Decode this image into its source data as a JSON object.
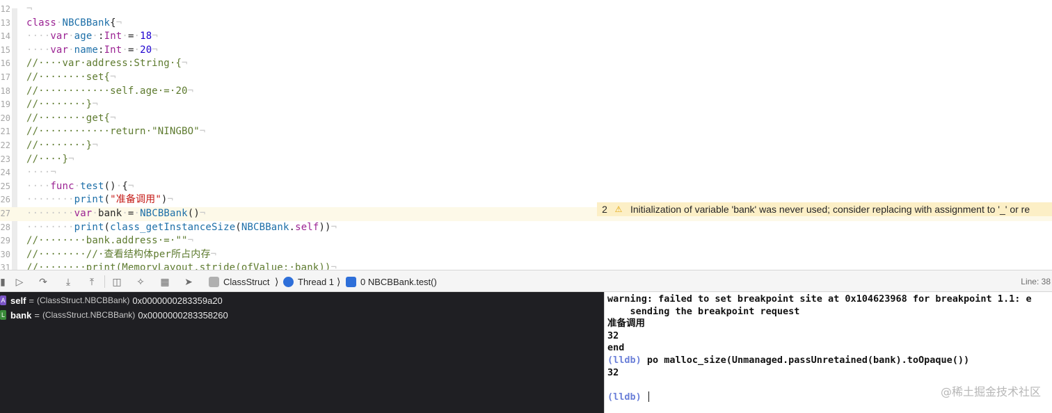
{
  "editor": {
    "lines": [
      {
        "num": "12",
        "segs": [
          {
            "t": "¬",
            "c": "ws"
          }
        ]
      },
      {
        "num": "13",
        "segs": [
          {
            "t": "class",
            "c": "kw"
          },
          {
            "t": "·",
            "c": "ws"
          },
          {
            "t": "NBCBBank",
            "c": "ty"
          },
          {
            "t": "{",
            "c": ""
          },
          {
            "t": "¬",
            "c": "ws"
          }
        ]
      },
      {
        "num": "14",
        "segs": [
          {
            "t": "····",
            "c": "ws"
          },
          {
            "t": "var",
            "c": "kw"
          },
          {
            "t": "·",
            "c": "ws"
          },
          {
            "t": "age",
            "c": "ty"
          },
          {
            "t": "·",
            "c": "ws"
          },
          {
            "t": ":",
            "c": ""
          },
          {
            "t": "Int",
            "c": "kw"
          },
          {
            "t": "·",
            "c": "ws"
          },
          {
            "t": "=",
            "c": ""
          },
          {
            "t": "·",
            "c": "ws"
          },
          {
            "t": "18",
            "c": "num"
          },
          {
            "t": "¬",
            "c": "ws"
          }
        ]
      },
      {
        "num": "15",
        "segs": [
          {
            "t": "····",
            "c": "ws"
          },
          {
            "t": "var",
            "c": "kw"
          },
          {
            "t": "·",
            "c": "ws"
          },
          {
            "t": "name",
            "c": "ty"
          },
          {
            "t": ":",
            "c": ""
          },
          {
            "t": "Int",
            "c": "kw"
          },
          {
            "t": "·",
            "c": "ws"
          },
          {
            "t": "=",
            "c": ""
          },
          {
            "t": "·",
            "c": "ws"
          },
          {
            "t": "20",
            "c": "num"
          },
          {
            "t": "¬",
            "c": "ws"
          }
        ]
      },
      {
        "num": "16",
        "segs": [
          {
            "t": "//····var·address:String·{",
            "c": "cm"
          },
          {
            "t": "¬",
            "c": "ws"
          }
        ]
      },
      {
        "num": "17",
        "segs": [
          {
            "t": "//········set{",
            "c": "cm"
          },
          {
            "t": "¬",
            "c": "ws"
          }
        ]
      },
      {
        "num": "18",
        "segs": [
          {
            "t": "//············self.age·=·20",
            "c": "cm"
          },
          {
            "t": "¬",
            "c": "ws"
          }
        ]
      },
      {
        "num": "19",
        "segs": [
          {
            "t": "//········}",
            "c": "cm"
          },
          {
            "t": "¬",
            "c": "ws"
          }
        ]
      },
      {
        "num": "20",
        "segs": [
          {
            "t": "//········get{",
            "c": "cm"
          },
          {
            "t": "¬",
            "c": "ws"
          }
        ]
      },
      {
        "num": "21",
        "segs": [
          {
            "t": "//············return·\"NINGBO\"",
            "c": "cm"
          },
          {
            "t": "¬",
            "c": "ws"
          }
        ]
      },
      {
        "num": "22",
        "segs": [
          {
            "t": "//········}",
            "c": "cm"
          },
          {
            "t": "¬",
            "c": "ws"
          }
        ]
      },
      {
        "num": "23",
        "segs": [
          {
            "t": "//····}",
            "c": "cm"
          },
          {
            "t": "¬",
            "c": "ws"
          }
        ]
      },
      {
        "num": "24",
        "segs": [
          {
            "t": "····¬",
            "c": "ws"
          }
        ]
      },
      {
        "num": "25",
        "segs": [
          {
            "t": "····",
            "c": "ws"
          },
          {
            "t": "func",
            "c": "kw"
          },
          {
            "t": "·",
            "c": "ws"
          },
          {
            "t": "test",
            "c": "ty"
          },
          {
            "t": "()",
            "c": ""
          },
          {
            "t": "·",
            "c": "ws"
          },
          {
            "t": "{",
            "c": ""
          },
          {
            "t": "¬",
            "c": "ws"
          }
        ]
      },
      {
        "num": "26",
        "segs": [
          {
            "t": "········",
            "c": "ws"
          },
          {
            "t": "print",
            "c": "ty"
          },
          {
            "t": "(",
            "c": ""
          },
          {
            "t": "\"准备调用\"",
            "c": "str"
          },
          {
            "t": ")",
            "c": ""
          },
          {
            "t": "¬",
            "c": "ws"
          }
        ]
      },
      {
        "num": "27",
        "segs": [
          {
            "t": "········",
            "c": "ws"
          },
          {
            "t": "var",
            "c": "kw"
          },
          {
            "t": "·",
            "c": "ws"
          },
          {
            "t": "bank",
            "c": ""
          },
          {
            "t": "·",
            "c": "ws"
          },
          {
            "t": "=",
            "c": ""
          },
          {
            "t": "·",
            "c": "ws"
          },
          {
            "t": "NBCBBank",
            "c": "ty"
          },
          {
            "t": "()",
            "c": ""
          },
          {
            "t": "¬",
            "c": "ws"
          }
        ]
      },
      {
        "num": "28",
        "segs": [
          {
            "t": "········",
            "c": "ws"
          },
          {
            "t": "print",
            "c": "ty"
          },
          {
            "t": "(",
            "c": ""
          },
          {
            "t": "class_getInstanceSize",
            "c": "ty"
          },
          {
            "t": "(",
            "c": ""
          },
          {
            "t": "NBCBBank",
            "c": "ty"
          },
          {
            "t": ".",
            "c": ""
          },
          {
            "t": "self",
            "c": "kw"
          },
          {
            "t": "))",
            "c": ""
          },
          {
            "t": "¬",
            "c": "ws"
          }
        ]
      },
      {
        "num": "29",
        "segs": [
          {
            "t": "//········bank.address·=·\"\"",
            "c": "cm"
          },
          {
            "t": "¬",
            "c": "ws"
          }
        ]
      },
      {
        "num": "30",
        "segs": [
          {
            "t": "//········//·查看结构体per所占内存",
            "c": "cm"
          },
          {
            "t": "¬",
            "c": "ws"
          }
        ]
      },
      {
        "num": "31",
        "segs": [
          {
            "t": "//········print(MemoryLayout.stride(ofValue:·bank))",
            "c": "cm"
          },
          {
            "t": "¬",
            "c": "ws"
          }
        ]
      }
    ],
    "highlighted_line": "27",
    "warning": {
      "count": "2",
      "icon": "warning-triangle-icon",
      "text": "Initialization of variable 'bank' was never used; consider replacing with assignment to '_' or re"
    }
  },
  "debug_bar": {
    "breadcrumbs": {
      "target": "ClassStruct",
      "thread": "Thread 1",
      "frame": "0 NBCBBank.test()"
    },
    "line_indicator": "Line: 38"
  },
  "variables": [
    {
      "badge": "A",
      "badge_color": "#7b55c7",
      "name": "self",
      "eq": "=",
      "type": "(ClassStruct.NBCBBank)",
      "value": "0x0000000283359a20"
    },
    {
      "badge": "L",
      "badge_color": "#3a8b3a",
      "name": "bank",
      "eq": "=",
      "type": "(ClassStruct.NBCBBank)",
      "value": "0x0000000283358260"
    }
  ],
  "console": {
    "lines": [
      {
        "text": "warning: failed to set breakpoint site at 0x104623968 for breakpoint 1.1: e",
        "prompt": ""
      },
      {
        "text": "    sending the breakpoint request",
        "prompt": ""
      },
      {
        "text": "准备调用",
        "prompt": ""
      },
      {
        "text": "32",
        "prompt": ""
      },
      {
        "text": "end",
        "prompt": ""
      },
      {
        "text": " po malloc_size(Unmanaged.passUnretained(bank).toOpaque())",
        "prompt": "(lldb)"
      },
      {
        "text": "32",
        "prompt": ""
      },
      {
        "text": "",
        "prompt": ""
      },
      {
        "text": " ",
        "prompt": "(lldb)",
        "cursor": true
      }
    ],
    "watermark": "@稀土掘金技术社区"
  }
}
